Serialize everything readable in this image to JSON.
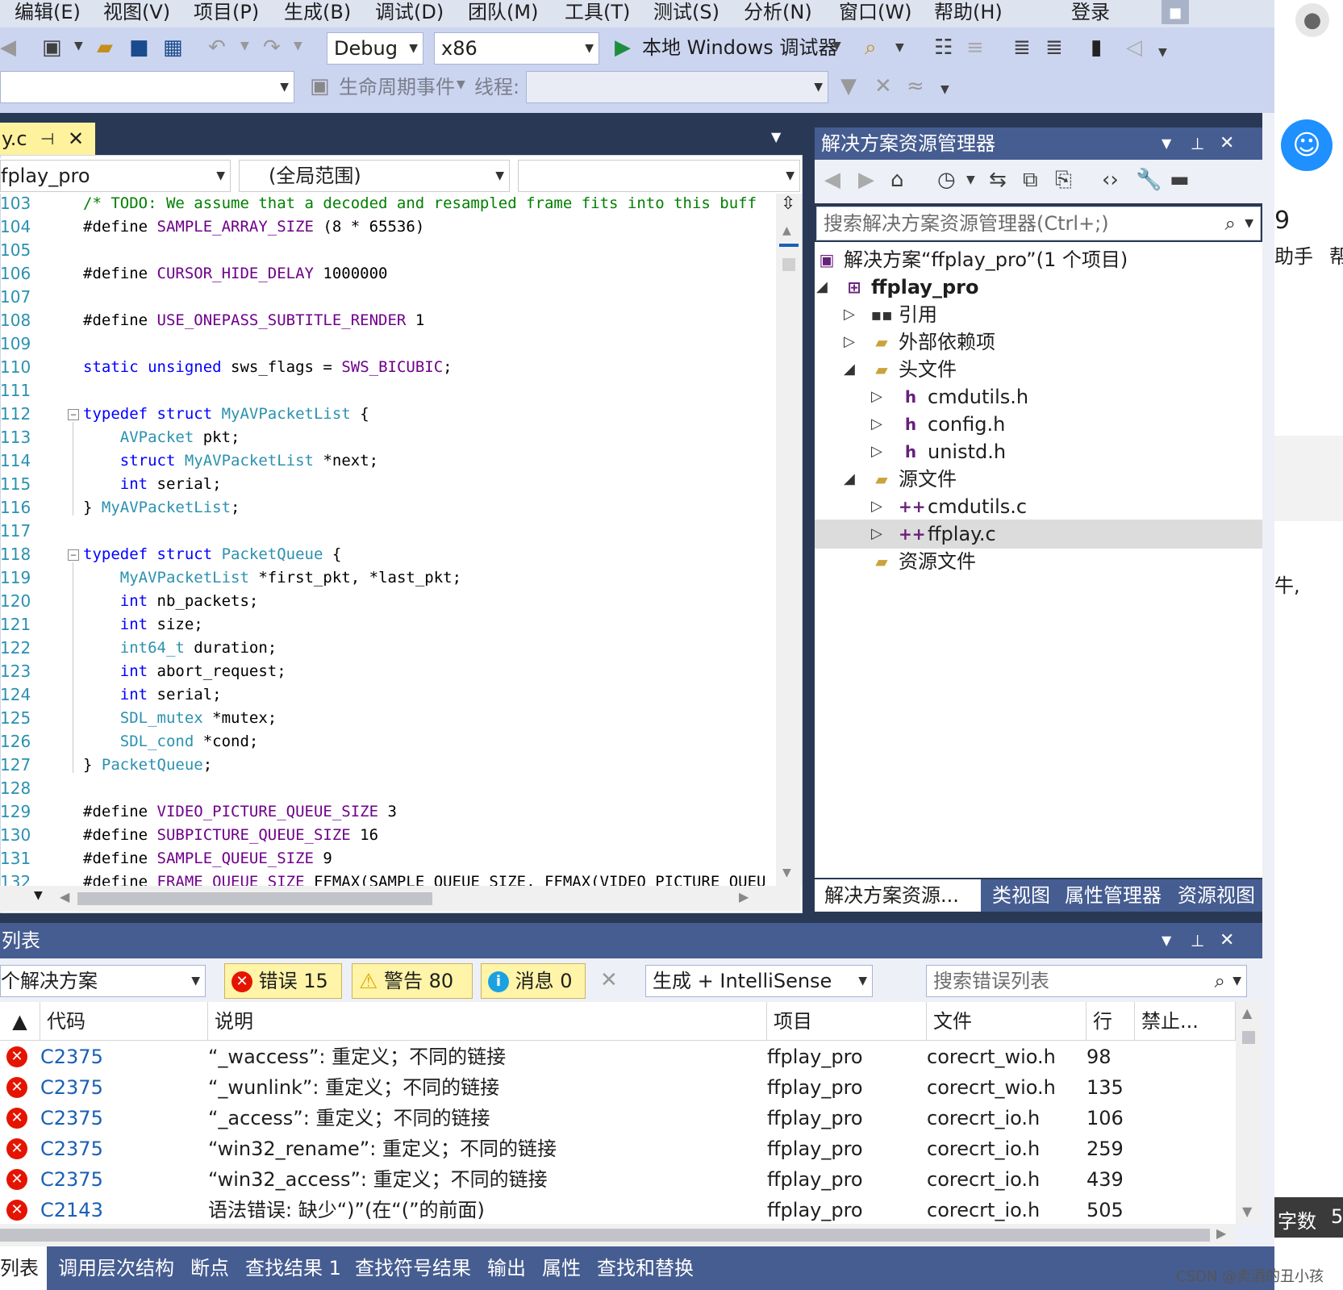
{
  "menu": [
    "编辑(E)",
    "视图(V)",
    "项目(P)",
    "生成(B)",
    "调试(D)",
    "团队(M)",
    "工具(T)",
    "测试(S)",
    "分析(N)",
    "窗口(W)",
    "帮助(H)"
  ],
  "login": "登录",
  "toolbar": {
    "config": "Debug",
    "platform": "x86",
    "run_label": "本地 Windows 调试器",
    "lifecycle": "生命周期事件",
    "thread_label": "线程:"
  },
  "editor": {
    "tab_name": "y.c",
    "project_combo": "fplay_pro",
    "scope_combo": "(全局范围)",
    "lines": [
      {
        "n": "103",
        "parts": [
          [
            "cm",
            "/* TODO: We assume that a decoded and resampled frame fits into this buff"
          ]
        ]
      },
      {
        "n": "104",
        "parts": [
          [
            "pl",
            "#define "
          ],
          [
            "mac",
            "SAMPLE_ARRAY_SIZE"
          ],
          [
            "pl",
            " (8 * 65536)"
          ]
        ]
      },
      {
        "n": "105",
        "parts": []
      },
      {
        "n": "106",
        "parts": [
          [
            "pl",
            "#define "
          ],
          [
            "mac",
            "CURSOR_HIDE_DELAY"
          ],
          [
            "pl",
            " 1000000"
          ]
        ]
      },
      {
        "n": "107",
        "parts": []
      },
      {
        "n": "108",
        "parts": [
          [
            "pl",
            "#define "
          ],
          [
            "mac",
            "USE_ONEPASS_SUBTITLE_RENDER"
          ],
          [
            "pl",
            " 1"
          ]
        ]
      },
      {
        "n": "109",
        "parts": []
      },
      {
        "n": "110",
        "parts": [
          [
            "kw",
            "static unsigned"
          ],
          [
            "pl",
            " sws_flags = "
          ],
          [
            "mac",
            "SWS_BICUBIC"
          ],
          [
            "pl",
            ";"
          ]
        ]
      },
      {
        "n": "111",
        "parts": []
      },
      {
        "n": "112",
        "parts": [
          [
            "kw",
            "typedef struct "
          ],
          [
            "ty",
            "MyAVPacketList"
          ],
          [
            "pl",
            " {"
          ]
        ]
      },
      {
        "n": "113",
        "parts": [
          [
            "pl",
            "    "
          ],
          [
            "ty",
            "AVPacket"
          ],
          [
            "pl",
            " pkt;"
          ]
        ]
      },
      {
        "n": "114",
        "parts": [
          [
            "pl",
            "    "
          ],
          [
            "kw",
            "struct "
          ],
          [
            "ty",
            "MyAVPacketList"
          ],
          [
            "pl",
            " *next;"
          ]
        ]
      },
      {
        "n": "115",
        "parts": [
          [
            "pl",
            "    "
          ],
          [
            "kw",
            "int"
          ],
          [
            "pl",
            " serial;"
          ]
        ]
      },
      {
        "n": "116",
        "parts": [
          [
            "pl",
            "} "
          ],
          [
            "ty",
            "MyAVPacketList"
          ],
          [
            "pl",
            ";"
          ]
        ]
      },
      {
        "n": "117",
        "parts": []
      },
      {
        "n": "118",
        "parts": [
          [
            "kw",
            "typedef struct "
          ],
          [
            "ty",
            "PacketQueue"
          ],
          [
            "pl",
            " {"
          ]
        ]
      },
      {
        "n": "119",
        "parts": [
          [
            "pl",
            "    "
          ],
          [
            "ty",
            "MyAVPacketList"
          ],
          [
            "pl",
            " *first_pkt, *last_pkt;"
          ]
        ]
      },
      {
        "n": "120",
        "parts": [
          [
            "pl",
            "    "
          ],
          [
            "kw",
            "int"
          ],
          [
            "pl",
            " nb_packets;"
          ]
        ]
      },
      {
        "n": "121",
        "parts": [
          [
            "pl",
            "    "
          ],
          [
            "kw",
            "int"
          ],
          [
            "pl",
            " size;"
          ]
        ]
      },
      {
        "n": "122",
        "parts": [
          [
            "pl",
            "    "
          ],
          [
            "ty",
            "int64_t"
          ],
          [
            "pl",
            " duration;"
          ]
        ]
      },
      {
        "n": "123",
        "parts": [
          [
            "pl",
            "    "
          ],
          [
            "kw",
            "int"
          ],
          [
            "pl",
            " abort_request;"
          ]
        ]
      },
      {
        "n": "124",
        "parts": [
          [
            "pl",
            "    "
          ],
          [
            "kw",
            "int"
          ],
          [
            "pl",
            " serial;"
          ]
        ]
      },
      {
        "n": "125",
        "parts": [
          [
            "pl",
            "    "
          ],
          [
            "ty",
            "SDL_mutex"
          ],
          [
            "pl",
            " *mutex;"
          ]
        ]
      },
      {
        "n": "126",
        "parts": [
          [
            "pl",
            "    "
          ],
          [
            "ty",
            "SDL_cond"
          ],
          [
            "pl",
            " *cond;"
          ]
        ]
      },
      {
        "n": "127",
        "parts": [
          [
            "pl",
            "} "
          ],
          [
            "ty",
            "PacketQueue"
          ],
          [
            "pl",
            ";"
          ]
        ]
      },
      {
        "n": "128",
        "parts": []
      },
      {
        "n": "129",
        "parts": [
          [
            "pl",
            "#define "
          ],
          [
            "mac",
            "VIDEO_PICTURE_QUEUE_SIZE"
          ],
          [
            "pl",
            " 3"
          ]
        ]
      },
      {
        "n": "130",
        "parts": [
          [
            "pl",
            "#define "
          ],
          [
            "mac",
            "SUBPICTURE_QUEUE_SIZE"
          ],
          [
            "pl",
            " 16"
          ]
        ]
      },
      {
        "n": "131",
        "parts": [
          [
            "pl",
            "#define "
          ],
          [
            "mac",
            "SAMPLE_QUEUE_SIZE"
          ],
          [
            "pl",
            " 9"
          ]
        ]
      },
      {
        "n": "132",
        "parts": [
          [
            "pl",
            "#define "
          ],
          [
            "mac",
            "FRAME_QUEUE_SIZE"
          ],
          [
            "pl",
            " FFMAX(SAMPLE_QUEUE_SIZE, FFMAX(VIDEO_PICTURE_QUEU"
          ]
        ]
      }
    ]
  },
  "solution": {
    "title": "解决方案资源管理器",
    "search_placeholder": "搜索解决方案资源管理器(Ctrl+;)",
    "tree": [
      {
        "label": "解决方案“ffplay_pro”(1 个项目)",
        "level": 0,
        "tri": "",
        "icon": "solution"
      },
      {
        "label": "ffplay_pro",
        "level": 0,
        "tri": "◢",
        "icon": "project",
        "bold": true
      },
      {
        "label": "引用",
        "level": 1,
        "tri": "▷",
        "icon": "refs"
      },
      {
        "label": "外部依赖项",
        "level": 1,
        "tri": "▷",
        "icon": "folder"
      },
      {
        "label": "头文件",
        "level": 1,
        "tri": "◢",
        "icon": "folder"
      },
      {
        "label": "cmdutils.h",
        "level": 2,
        "tri": "▷",
        "icon": "header"
      },
      {
        "label": "config.h",
        "level": 2,
        "tri": "▷",
        "icon": "header"
      },
      {
        "label": "unistd.h",
        "level": 2,
        "tri": "▷",
        "icon": "header"
      },
      {
        "label": "源文件",
        "level": 1,
        "tri": "◢",
        "icon": "folder"
      },
      {
        "label": "cmdutils.c",
        "level": 2,
        "tri": "▷",
        "icon": "cpp"
      },
      {
        "label": "ffplay.c",
        "level": 2,
        "tri": "▷",
        "icon": "cpp",
        "selected": true
      },
      {
        "label": "资源文件",
        "level": 1,
        "tri": "",
        "icon": "folder"
      }
    ],
    "tabs": [
      "解决方案资源...",
      "类视图",
      "属性管理器",
      "资源视图"
    ]
  },
  "errors": {
    "title": "列表",
    "scope": "个解决方案",
    "err_label": "错误 15",
    "warn_label": "警告 80",
    "msg_label": "消息 0",
    "build_combo": "生成 + IntelliSense",
    "search_placeholder": "搜索错误列表",
    "columns": [
      "代码",
      "说明",
      "项目",
      "文件",
      "行",
      "禁止..."
    ],
    "rows": [
      {
        "code": "C2375",
        "desc": "“_waccess”: 重定义；不同的链接",
        "project": "ffplay_pro",
        "file": "corecrt_wio.h",
        "line": "98"
      },
      {
        "code": "C2375",
        "desc": "“_wunlink”: 重定义；不同的链接",
        "project": "ffplay_pro",
        "file": "corecrt_wio.h",
        "line": "135"
      },
      {
        "code": "C2375",
        "desc": "“_access”: 重定义；不同的链接",
        "project": "ffplay_pro",
        "file": "corecrt_io.h",
        "line": "106"
      },
      {
        "code": "C2375",
        "desc": "“win32_rename”: 重定义；不同的链接",
        "project": "ffplay_pro",
        "file": "corecrt_io.h",
        "line": "259"
      },
      {
        "code": "C2375",
        "desc": "“win32_access”: 重定义；不同的链接",
        "project": "ffplay_pro",
        "file": "corecrt_io.h",
        "line": "439"
      },
      {
        "code": "C2143",
        "desc": "语法错误: 缺少“)”(在“(”的前面)",
        "project": "ffplay_pro",
        "file": "corecrt_io.h",
        "line": "505"
      }
    ]
  },
  "bottom_tabs": [
    "列表",
    "调用层次结构",
    "断点",
    "查找结果 1",
    "查找符号结果",
    "输出",
    "属性",
    "查找和替换"
  ],
  "right": {
    "t1": "9",
    "t2": "助手",
    "t3": "帮",
    "t4": "牛,",
    "t5": "字数",
    "t6": "5"
  },
  "watermark": "CSDN @卖酒的丑小孩",
  "colors": {
    "vs_blue": "#465d91",
    "toolbar": "#ccd5f0",
    "tab_yellow": "#fff29d",
    "error_red": "#e51400",
    "warn_yellow": "#ffcc00",
    "info_blue": "#1ba1e2"
  }
}
